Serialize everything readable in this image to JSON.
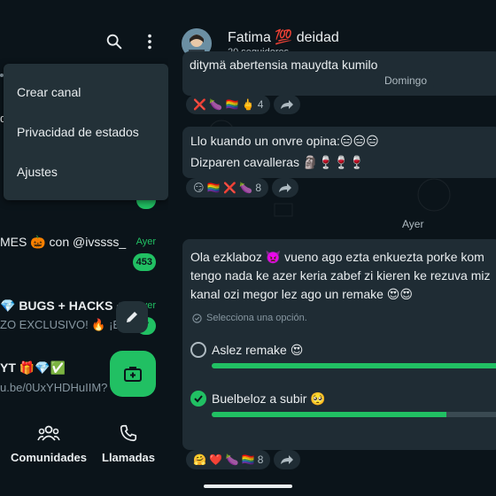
{
  "left_menu": {
    "items": [
      "Crear canal",
      "Privacidad de estados",
      "Ajustes"
    ]
  },
  "left_partial": {
    "d_label": "d"
  },
  "chats": [
    {
      "name": "MES 🎃 con @ivssss_",
      "time": "Ayer",
      "badge": "453",
      "preview": ""
    },
    {
      "name": "💎 BUGS + HACKS + ",
      "time": "yer",
      "badge": "7",
      "preview": "ZO EXCLUSIVO! 🔥  ¡E"
    },
    {
      "name": "YT 🎁💎✅",
      "time": "",
      "badge": "",
      "preview": "u.be/0UxYHDHuIIM?"
    }
  ],
  "bottom_nav": {
    "communities": "Comunidades",
    "calls": "Llamadas"
  },
  "channel": {
    "name": "Fatima 💯 deidad",
    "followers": "20 seguidores"
  },
  "messages": {
    "m1_partial": "ditymä abertensia mauydta kumilo",
    "m1_tooltip": "Domingo",
    "m1_reacts": "❌ 🍆 🏳️‍🌈 🖕",
    "m1_count": "4",
    "m2_line1": "Llo kuando un onvre opina:😑😑😑",
    "m2_line2": "Dizparen cavalleras 🗿🍷🍷🍷",
    "m2_reacts": "😏 🏳️‍🌈 ❌ 🍆",
    "m2_count": "8",
    "date_chip": "Ayer",
    "poll_line1": "Ola ezklaboz 👿 vueno ago ezta enkuezta porke kom",
    "poll_line2": "tengo nada ke azer keria zabef zi kieren ke rezuva miz",
    "poll_line3": "kanal ozi megor lez ago un remake 😍😍",
    "poll_hint": "Selecciona una opción.",
    "option1": "Aslez remake 😍",
    "option1_share": 1.0,
    "option2": "Buelbeloz a subir 🥺",
    "option2_share": 0.81,
    "m3_reacts": "🤗 ❤️ 🍆 🏳️‍🌈",
    "m3_count": "8"
  },
  "colors": {
    "accent": "#21c063",
    "bubble": "#1f2c34",
    "bg": "#0b141a",
    "menu": "#233138"
  }
}
